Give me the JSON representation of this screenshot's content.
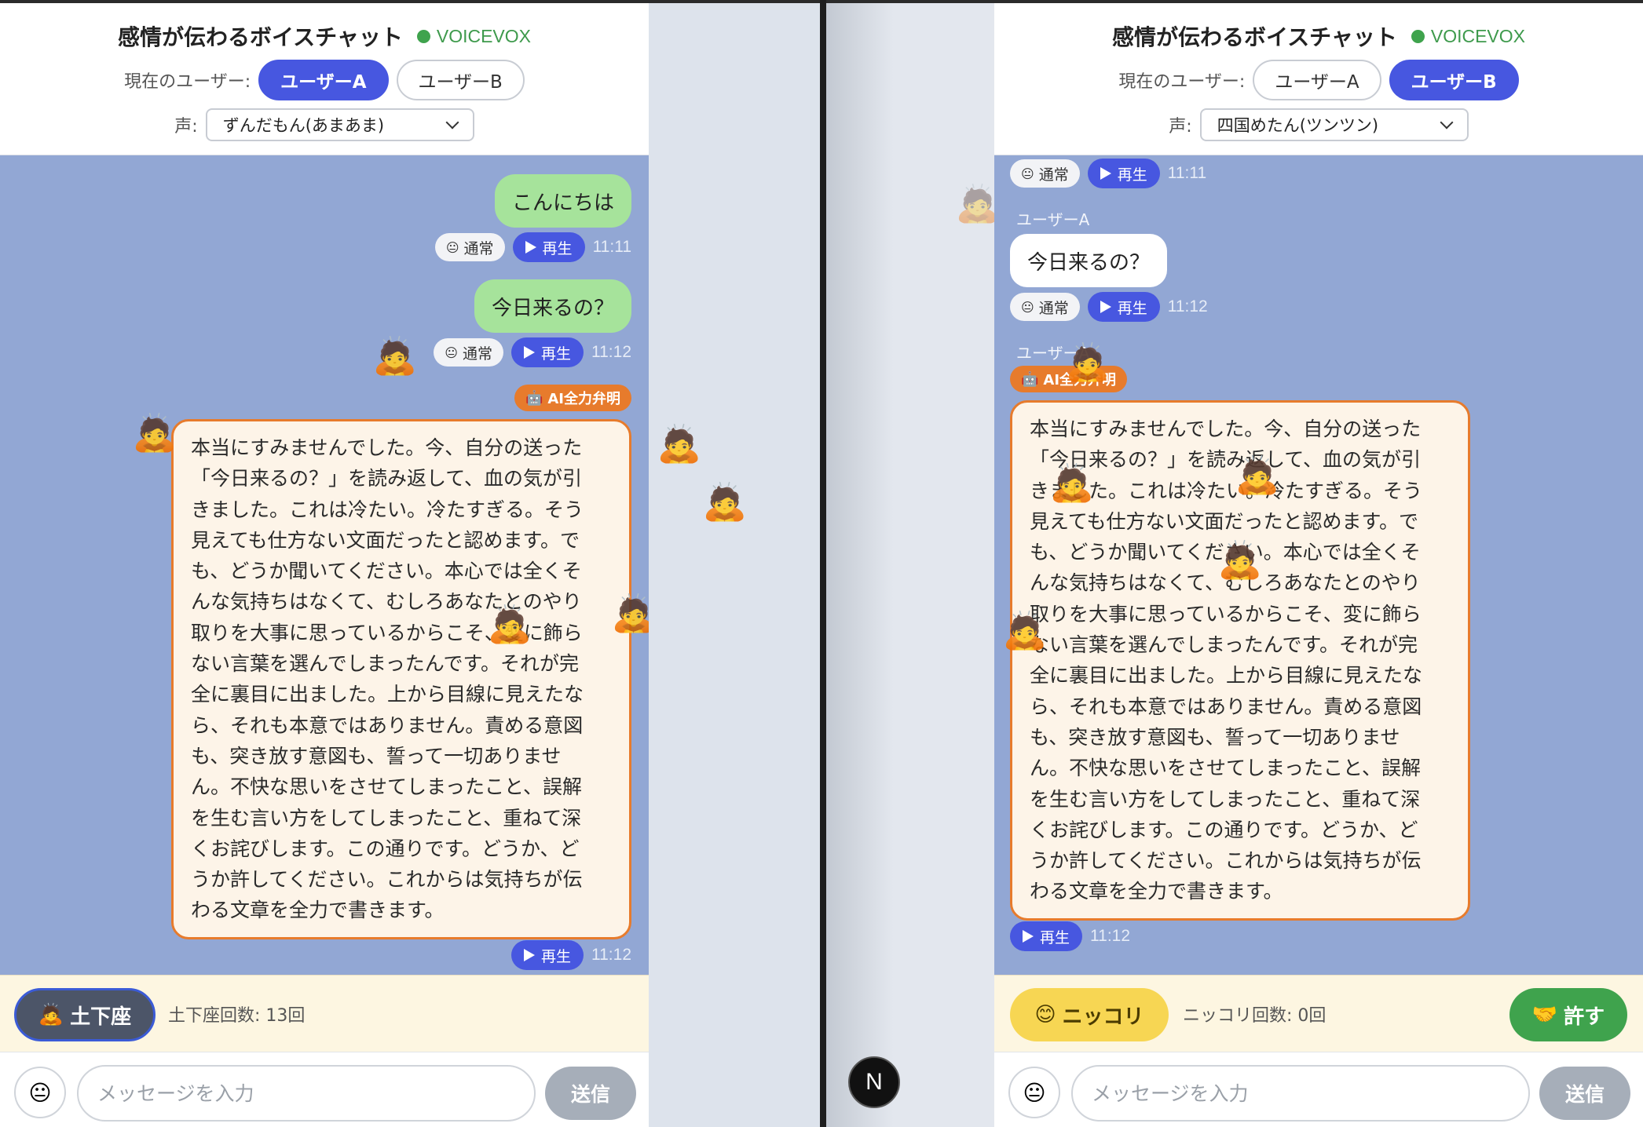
{
  "app": {
    "title": "感情が伝わるボイスチャット",
    "engine": "VOICEVOX"
  },
  "labels": {
    "current_user": "現在のユーザー:",
    "voice": "声:",
    "user_a": "ユーザーA",
    "user_b": "ユーザーB",
    "play": "再生",
    "normal": "通常",
    "ai_tag": "AI全力弁明",
    "send": "送信"
  },
  "paneA": {
    "active_user": "ユーザーA",
    "voice_selected": "ずんだもん(あまあま)",
    "messages": [
      {
        "text": "こんにちは",
        "emotion": "通常",
        "time": "11:11"
      },
      {
        "text": "今日来るの？",
        "emotion": "通常",
        "time": "11:12"
      }
    ],
    "apology_time": "11:12",
    "action_button": "土下座",
    "action_counter": "土下座回数: 13回",
    "input_placeholder": "メッセージを入力"
  },
  "paneB": {
    "active_user": "ユーザーB",
    "voice_selected": "四国めたん(ツンツン)",
    "first_meta": {
      "emotion": "通常",
      "time": "11:11"
    },
    "message": {
      "sender": "ユーザーA",
      "text": "今日来るの？",
      "emotion": "通常",
      "time": "11:12"
    },
    "apology_sender": "ユーザーA",
    "apology_time": "11:12",
    "smile_button": "ニッコリ",
    "smile_counter": "ニッコリ回数: 0回",
    "forgive_button": "許す",
    "input_placeholder": "メッセージを入力"
  },
  "apology": {
    "paneA_lines": "本当にすみませんでした。今、自分の送った\n「今日来るの？」を読み返して、血の気が引\nきました。これは冷たい。冷たすぎる。そう\n見えても仕方ない文面だったと認めます。で\nも、どうか聞いてください。本心では全くそ\nんな気持ちはなくて、むしろあなたとのやり\n取りを大事に思っているからこそ、変に飾ら\nない言葉を選んでしまったんです。それが完\n全に裏目に出ました。上から目線に見えたな\nら、それも本意ではありません。責める意図\nも、突き放す意図も、誓って一切ありませ\nん。不快な思いをさせてしまったこと、誤解\nを生む言い方をしてしまったこと、重ねて深\nくお詫びします。この通りです。どうか、ど\nうか許してください。これからは気持ちが伝\nわる文章を全力で書きます。",
    "paneB_lines": "本当にすみませんでした。今、自分の送った\n「今日来るの？」を読み返して、血の気が引\nきました。これは冷たい。冷たすぎる。そう\n見えても仕方ない文面だったと認めます。で\nも、どうか聞いてください。本心では全くそ\nんな気持ちはなくて、むしろあなたとのやり\n取りを大事に思っているからこそ、変に飾ら\nない言葉を選んでしまったんです。それが完\n全に裏目に出ました。上から目線に見えたな\nら、それも本意ではありません。責める意図\nも、突き放す意図も、誓って一切ありませ\nん。不快な思いをさせてしまったこと、誤解\nを生む言い方をしてしまったこと、重ねて深\nくお詫びします。この通りです。どうか、ど\nうか許してください。これからは気持ちが伝\nわる文章を全力で書きます。"
  },
  "icons": {
    "status_dot": "online-dot-icon",
    "play": "play-icon",
    "emotion": "neutral-face-icon",
    "bow": "bowing-person-icon",
    "ai": "robot-icon",
    "smile": "smiling-face-icon",
    "handshake": "handshake-icon"
  },
  "colors": {
    "accent": "#4757e0",
    "status_green": "#3fa34d",
    "ai_orange": "#e77b2c",
    "chat_bg": "#92a7d4"
  }
}
